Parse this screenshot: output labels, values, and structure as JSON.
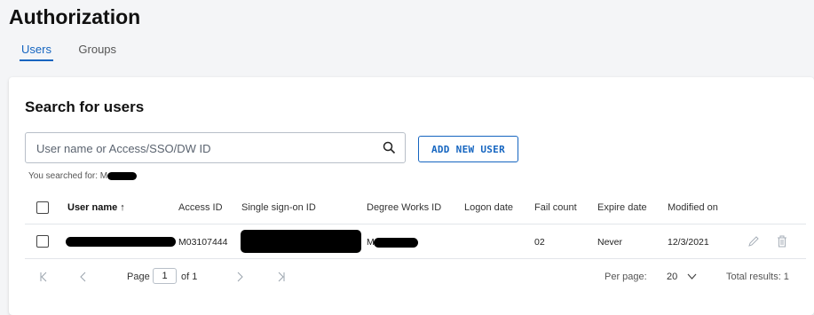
{
  "page": {
    "title": "Authorization"
  },
  "tabs": [
    {
      "label": "Users",
      "active": true
    },
    {
      "label": "Groups",
      "active": false
    }
  ],
  "search": {
    "title": "Search for users",
    "placeholder": "User name or Access/SSO/DW ID",
    "value": "",
    "add_button_label": "ADD NEW USER",
    "searched_for_label": "You searched for: M"
  },
  "table": {
    "columns": [
      "User name ↑",
      "Access ID",
      "Single sign-on ID",
      "Degree Works ID",
      "Logon date",
      "Fail count",
      "Expire date",
      "Modified on"
    ],
    "rows": [
      {
        "user_name": "",
        "access_id": "M03107444",
        "sso_id": "",
        "degree_works_id": "M",
        "logon_date": "",
        "fail_count": "02",
        "expire_date": "Never",
        "modified_on": "12/3/2021"
      }
    ]
  },
  "pagination": {
    "page_label": "Page",
    "page_value": "1",
    "of_label": "of 1",
    "per_page_label": "Per page:",
    "per_page_value": "20",
    "total_label": "Total results: 1"
  },
  "colors": {
    "accent": "#1565c0"
  }
}
